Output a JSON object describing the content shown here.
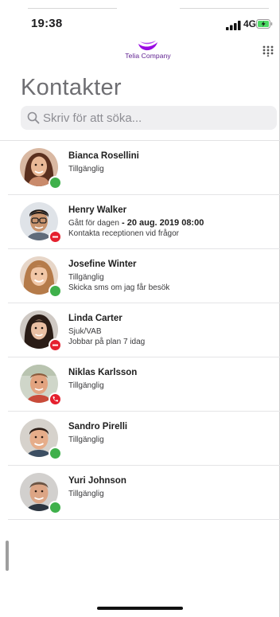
{
  "status_bar": {
    "time": "19:38",
    "network": "4G"
  },
  "header": {
    "logo_text": "Telia Company",
    "title": "Kontakter"
  },
  "search": {
    "placeholder": "Skriv för att söka..."
  },
  "colors": {
    "available": "#3fb04b",
    "busy": "#e5202e",
    "brand_purple": "#990ae3"
  },
  "contacts": [
    {
      "name": "Bianca Rosellini",
      "status": "Tillgänglig",
      "status_until": "",
      "note": "",
      "presence": "available"
    },
    {
      "name": "Henry Walker",
      "status": "Gått för dagen",
      "status_until": " - 20 aug. 2019 08:00",
      "note": "Kontakta receptionen vid frågor",
      "presence": "busy"
    },
    {
      "name": "Josefine Winter",
      "status": "Tillgänglig",
      "status_until": "",
      "note": "Skicka sms om jag får besök",
      "presence": "available"
    },
    {
      "name": "Linda Carter",
      "status": "Sjuk/VAB",
      "status_until": "",
      "note": "Jobbar på plan 7 idag",
      "presence": "busy"
    },
    {
      "name": "Niklas Karlsson",
      "status": "Tillgänglig",
      "status_until": "",
      "note": "",
      "presence": "on-call"
    },
    {
      "name": "Sandro Pirelli",
      "status": "Tillgänglig",
      "status_until": "",
      "note": "",
      "presence": "available"
    },
    {
      "name": "Yuri Johnson",
      "status": "Tillgänglig",
      "status_until": "",
      "note": "",
      "presence": "available"
    }
  ]
}
